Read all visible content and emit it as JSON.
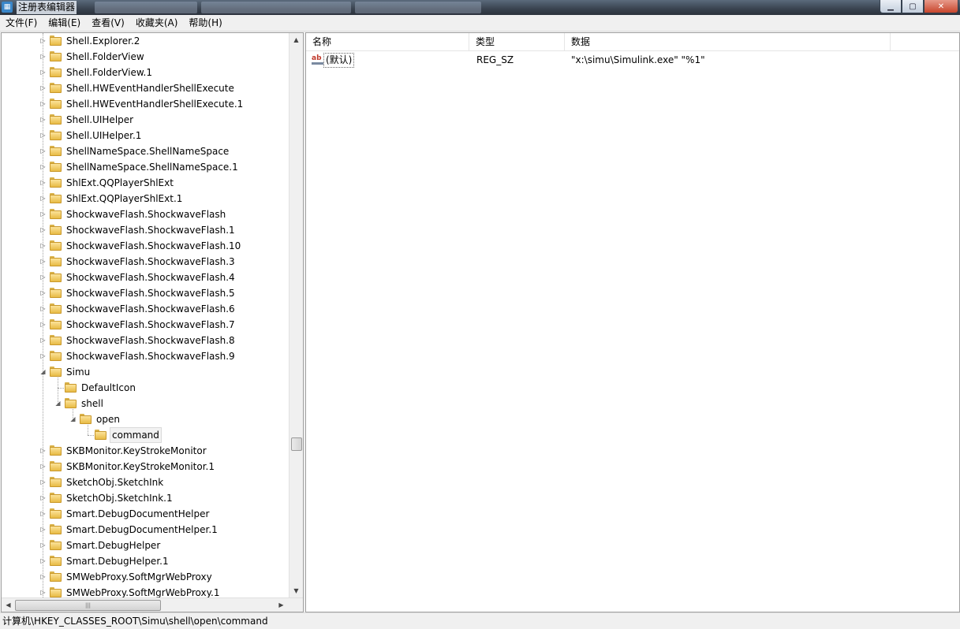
{
  "window": {
    "title": "注册表编辑器"
  },
  "menu": [
    "文件(F)",
    "编辑(E)",
    "查看(V)",
    "收藏夹(A)",
    "帮助(H)"
  ],
  "tree": [
    {
      "label": "Shell.Explorer.2",
      "level": 0,
      "expander": "collapsed"
    },
    {
      "label": "Shell.FolderView",
      "level": 0,
      "expander": "collapsed"
    },
    {
      "label": "Shell.FolderView.1",
      "level": 0,
      "expander": "collapsed"
    },
    {
      "label": "Shell.HWEventHandlerShellExecute",
      "level": 0,
      "expander": "collapsed"
    },
    {
      "label": "Shell.HWEventHandlerShellExecute.1",
      "level": 0,
      "expander": "collapsed"
    },
    {
      "label": "Shell.UIHelper",
      "level": 0,
      "expander": "collapsed"
    },
    {
      "label": "Shell.UIHelper.1",
      "level": 0,
      "expander": "collapsed"
    },
    {
      "label": "ShellNameSpace.ShellNameSpace",
      "level": 0,
      "expander": "collapsed"
    },
    {
      "label": "ShellNameSpace.ShellNameSpace.1",
      "level": 0,
      "expander": "collapsed"
    },
    {
      "label": "ShlExt.QQPlayerShlExt",
      "level": 0,
      "expander": "collapsed"
    },
    {
      "label": "ShlExt.QQPlayerShlExt.1",
      "level": 0,
      "expander": "collapsed"
    },
    {
      "label": "ShockwaveFlash.ShockwaveFlash",
      "level": 0,
      "expander": "collapsed"
    },
    {
      "label": "ShockwaveFlash.ShockwaveFlash.1",
      "level": 0,
      "expander": "collapsed"
    },
    {
      "label": "ShockwaveFlash.ShockwaveFlash.10",
      "level": 0,
      "expander": "collapsed"
    },
    {
      "label": "ShockwaveFlash.ShockwaveFlash.3",
      "level": 0,
      "expander": "collapsed"
    },
    {
      "label": "ShockwaveFlash.ShockwaveFlash.4",
      "level": 0,
      "expander": "collapsed"
    },
    {
      "label": "ShockwaveFlash.ShockwaveFlash.5",
      "level": 0,
      "expander": "collapsed"
    },
    {
      "label": "ShockwaveFlash.ShockwaveFlash.6",
      "level": 0,
      "expander": "collapsed"
    },
    {
      "label": "ShockwaveFlash.ShockwaveFlash.7",
      "level": 0,
      "expander": "collapsed"
    },
    {
      "label": "ShockwaveFlash.ShockwaveFlash.8",
      "level": 0,
      "expander": "collapsed"
    },
    {
      "label": "ShockwaveFlash.ShockwaveFlash.9",
      "level": 0,
      "expander": "collapsed"
    },
    {
      "label": "Simu",
      "level": 0,
      "expander": "expanded"
    },
    {
      "label": "DefaultIcon",
      "level": 1,
      "expander": "none"
    },
    {
      "label": "shell",
      "level": 1,
      "expander": "expanded"
    },
    {
      "label": "open",
      "level": 2,
      "expander": "expanded"
    },
    {
      "label": "command",
      "level": 3,
      "expander": "none",
      "selected": true
    },
    {
      "label": "SKBMonitor.KeyStrokeMonitor",
      "level": 0,
      "expander": "collapsed"
    },
    {
      "label": "SKBMonitor.KeyStrokeMonitor.1",
      "level": 0,
      "expander": "collapsed"
    },
    {
      "label": "SketchObj.SketchInk",
      "level": 0,
      "expander": "collapsed"
    },
    {
      "label": "SketchObj.SketchInk.1",
      "level": 0,
      "expander": "collapsed"
    },
    {
      "label": "Smart.DebugDocumentHelper",
      "level": 0,
      "expander": "collapsed"
    },
    {
      "label": "Smart.DebugDocumentHelper.1",
      "level": 0,
      "expander": "collapsed"
    },
    {
      "label": "Smart.DebugHelper",
      "level": 0,
      "expander": "collapsed"
    },
    {
      "label": "Smart.DebugHelper.1",
      "level": 0,
      "expander": "collapsed"
    },
    {
      "label": "SMWebProxy.SoftMgrWebProxy",
      "level": 0,
      "expander": "collapsed"
    },
    {
      "label": "SMWebProxy.SoftMgrWebProxy.1",
      "level": 0,
      "expander": "collapsed"
    }
  ],
  "list": {
    "columns": [
      "名称",
      "类型",
      "数据"
    ],
    "rows": [
      {
        "name": "(默认)",
        "type": "REG_SZ",
        "data": "\"x:\\simu\\Simulink.exe\" \"%1\"",
        "icon": "string-value-icon"
      }
    ]
  },
  "status": {
    "path": "计算机\\HKEY_CLASSES_ROOT\\Simu\\shell\\open\\command"
  },
  "colors": {
    "folder": "#e8bb45",
    "string_icon": "#c0392b",
    "titlebar": "#39424f"
  }
}
